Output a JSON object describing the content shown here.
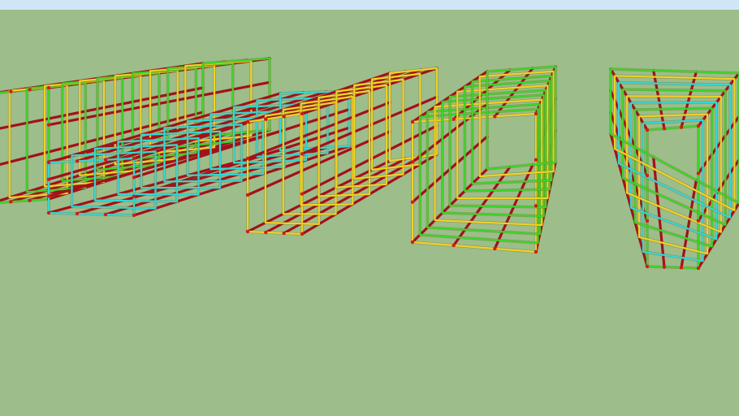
{
  "colors": {
    "sky": "#cfe6f7",
    "ground": "#9dbd8b",
    "longitudinal_bar": "#a4101a",
    "stirrup_yellow": "#f1d225",
    "stirrup_green": "#3fd42a",
    "stirrup_cyan": "#35d7d6",
    "bar_end_red": "#d31a1a"
  },
  "scene": {
    "type": "3d-model-viewport",
    "content": "rebar-cages",
    "cage_count": 4,
    "cages": [
      {
        "id": "cage-1",
        "stirrup_colors": [
          "green",
          "yellow"
        ]
      },
      {
        "id": "cage-2",
        "stirrup_colors": [
          "cyan",
          "yellow"
        ]
      },
      {
        "id": "cage-3",
        "stirrup_colors": [
          "green",
          "yellow"
        ]
      },
      {
        "id": "cage-4",
        "stirrup_colors": [
          "green",
          "cyan",
          "yellow"
        ]
      }
    ]
  }
}
